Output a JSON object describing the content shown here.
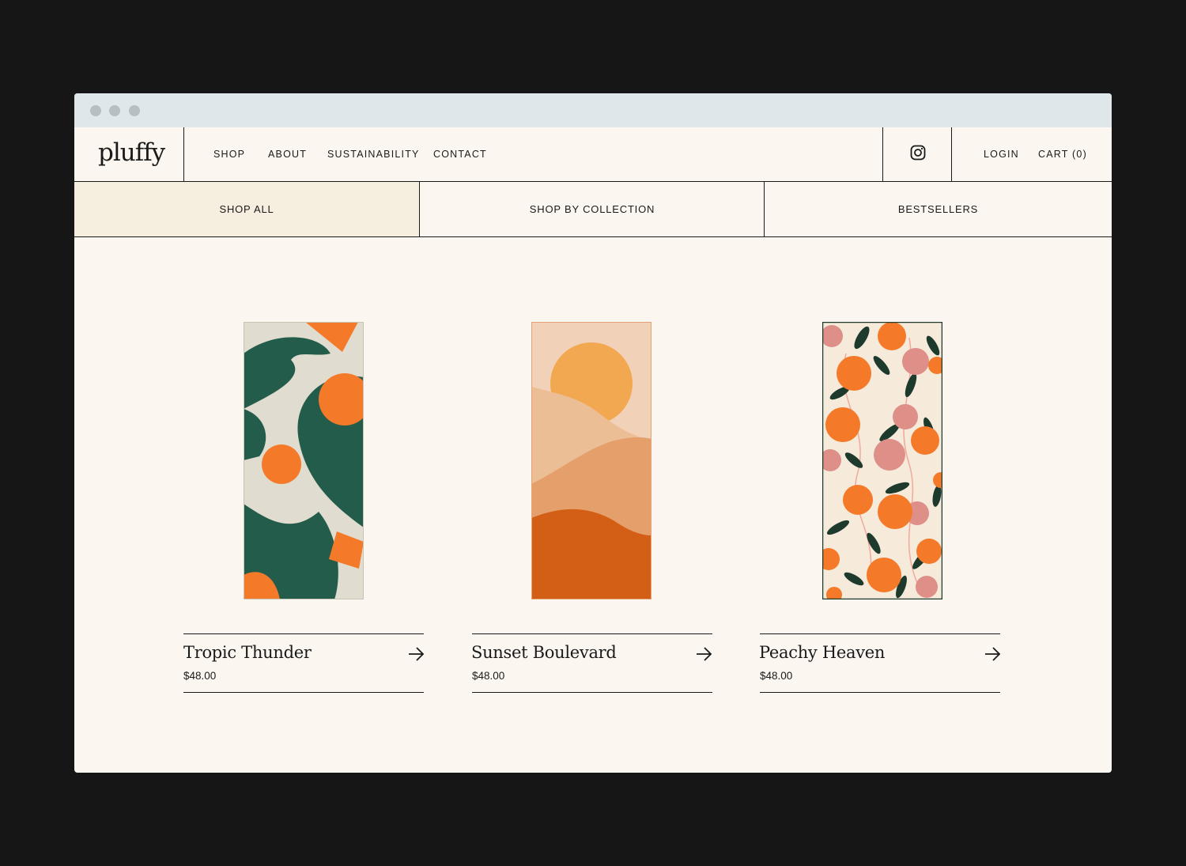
{
  "brand": {
    "logo_text": "pluffy"
  },
  "nav": {
    "items": [
      "SHOP",
      "ABOUT",
      "SUSTAINABILITY",
      "CONTACT"
    ]
  },
  "account": {
    "login": "LOGIN",
    "cart": "CART (0)"
  },
  "tabs": [
    "SHOP ALL",
    "SHOP BY COLLECTION",
    "BESTSELLERS"
  ],
  "products": [
    {
      "name": "Tropic Thunder",
      "price": "$48.00"
    },
    {
      "name": "Sunset Boulevard",
      "price": "$48.00"
    },
    {
      "name": "Peachy Heaven",
      "price": "$48.00"
    }
  ],
  "colors": {
    "page_bg": "#fbf7f0",
    "active_tab": "#f6efdf",
    "forest_green": "#235c4b",
    "orange": "#f47a2a",
    "peach": "#f0cdb1",
    "rust": "#d35e16",
    "pink": "#dd8f88"
  },
  "icons": {
    "social": "instagram-icon",
    "product_link": "arrow-right-icon"
  }
}
